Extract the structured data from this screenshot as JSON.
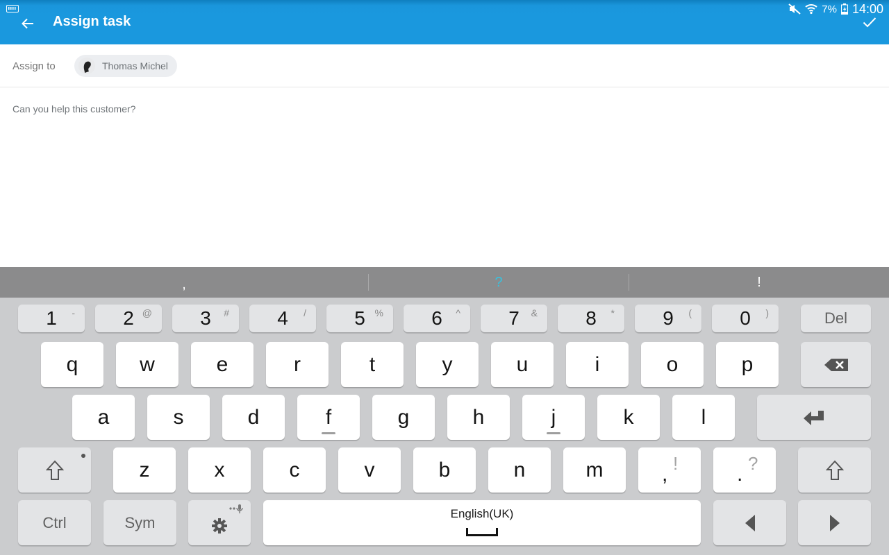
{
  "status_bar": {
    "left_icon": "keyboard-icon",
    "icons": [
      "mute-icon",
      "wifi-icon",
      "battery-charging-icon"
    ],
    "battery_percent": "7%",
    "time": "14:00"
  },
  "app_bar": {
    "back_icon": "arrow-left-icon",
    "title": "Assign task",
    "confirm_icon": "check-icon",
    "background_color": "#1a98de"
  },
  "form": {
    "assign_label": "Assign to",
    "assignee": {
      "name": "Thomas Michel",
      "avatar_icon": "avatar-icon"
    },
    "message": "Can you help this customer?"
  },
  "keyboard": {
    "suggestions": [
      ",",
      "?",
      "!"
    ],
    "suggestion_highlight_color": "#36c2df",
    "number_row": [
      {
        "main": "1",
        "alt": "-"
      },
      {
        "main": "2",
        "alt": "@"
      },
      {
        "main": "3",
        "alt": "#"
      },
      {
        "main": "4",
        "alt": "/"
      },
      {
        "main": "5",
        "alt": "%"
      },
      {
        "main": "6",
        "alt": "^"
      },
      {
        "main": "7",
        "alt": "&"
      },
      {
        "main": "8",
        "alt": "*"
      },
      {
        "main": "9",
        "alt": "("
      },
      {
        "main": "0",
        "alt": ")"
      }
    ],
    "del_label": "Del",
    "row_q": [
      "q",
      "w",
      "e",
      "r",
      "t",
      "y",
      "u",
      "i",
      "o",
      "p"
    ],
    "row_a": [
      "a",
      "s",
      "d",
      "f",
      "g",
      "h",
      "j",
      "k",
      "l"
    ],
    "row_z": [
      "z",
      "x",
      "c",
      "v",
      "b",
      "n",
      "m"
    ],
    "comma_key": {
      "main": ",",
      "alt": "!"
    },
    "period_key": {
      "main": ".",
      "alt": "?"
    },
    "ctrl_label": "Ctrl",
    "sym_label": "Sym",
    "space_label": "English(UK)",
    "icons": {
      "backspace": "backspace-icon",
      "enter": "enter-icon",
      "shift": "shift-icon",
      "settings": "gear-icon",
      "voice": "microphone-icon",
      "left": "arrow-left-key-icon",
      "right": "arrow-right-key-icon"
    }
  }
}
